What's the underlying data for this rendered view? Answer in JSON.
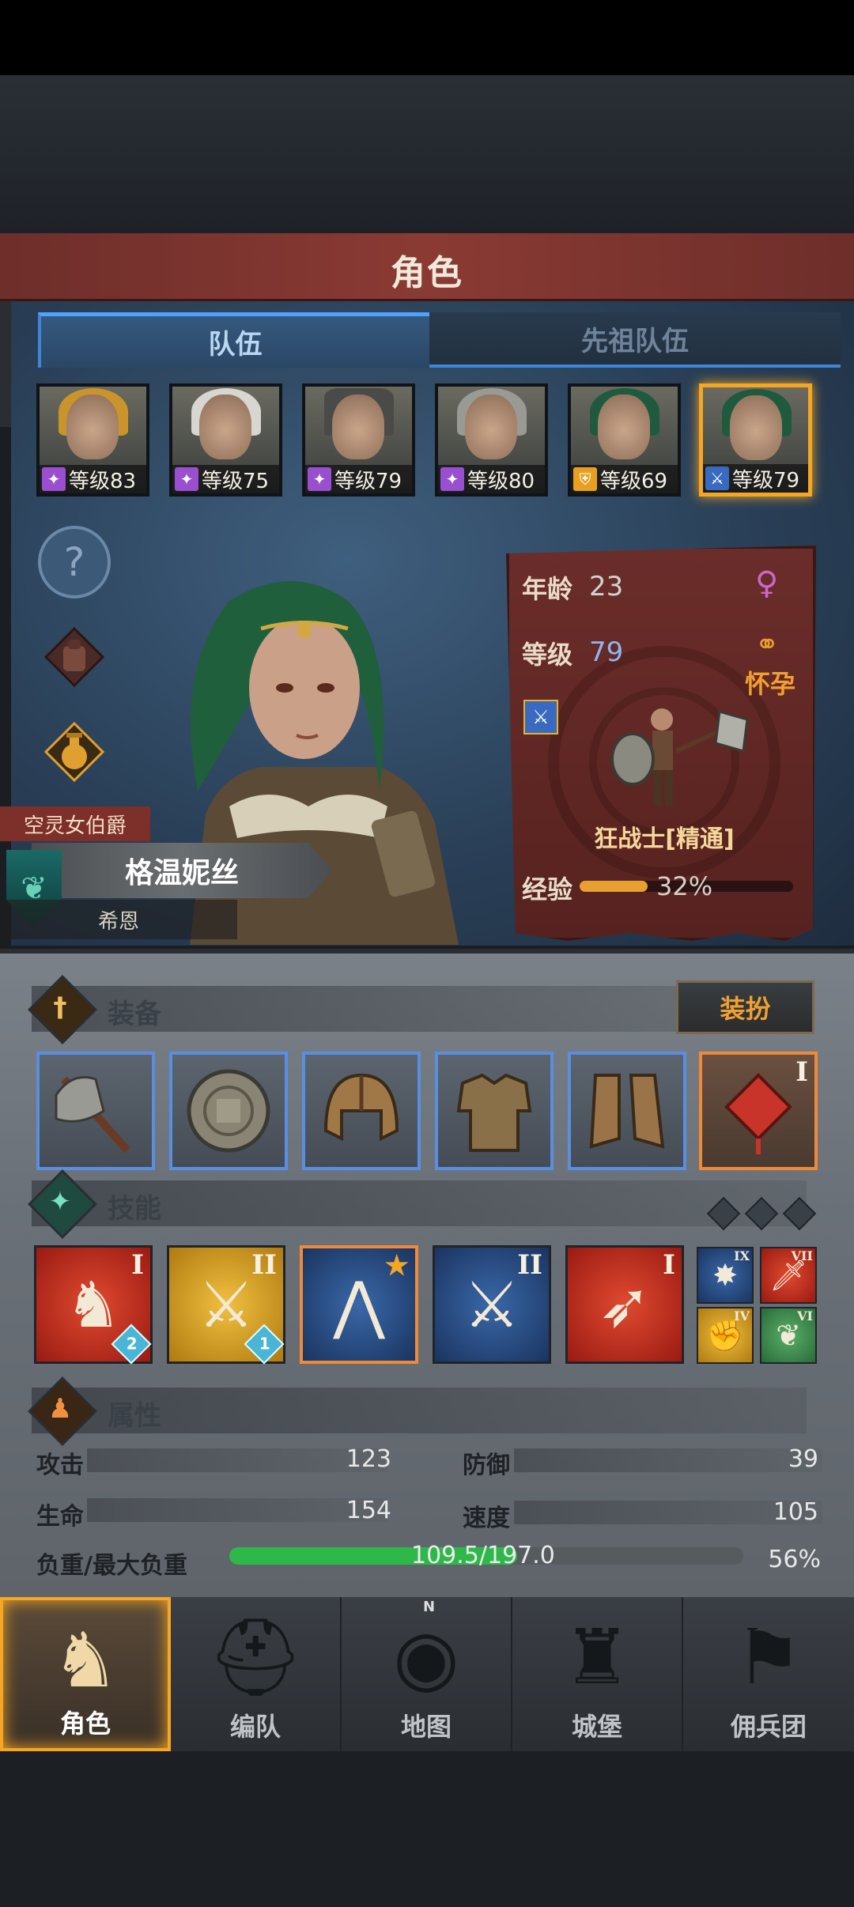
{
  "title": "角色",
  "tabs": [
    {
      "label": "队伍",
      "active": true
    },
    {
      "label": "先祖队伍",
      "active": false
    }
  ],
  "heroes": [
    {
      "label": "等级83",
      "class_icon": "wand-icon",
      "class_color": "#9a4fd0"
    },
    {
      "label": "等级75",
      "class_icon": "wand-icon",
      "class_color": "#9a4fd0"
    },
    {
      "label": "等级79",
      "class_icon": "wand-icon",
      "class_color": "#9a4fd0"
    },
    {
      "label": "等级80",
      "class_icon": "wand-icon",
      "class_color": "#9a4fd0"
    },
    {
      "label": "等级69",
      "class_icon": "shield-icon",
      "class_color": "#e8a020"
    },
    {
      "label": "等级79",
      "class_icon": "sword-icon",
      "class_color": "#3a6abf",
      "selected": true
    }
  ],
  "character": {
    "title": "空灵女伯爵",
    "name": "格温妮丝",
    "subname": "希恩"
  },
  "stats": {
    "age_label": "年龄",
    "age": "23",
    "level_label": "等级",
    "level": "79",
    "status": "怀孕",
    "class_name": "狂战士[精通]",
    "exp_label": "经验",
    "exp_pct": "32%",
    "exp_fraction": 0.32
  },
  "equipment": {
    "title": "装备",
    "dress_button": "装扮",
    "items": [
      {
        "icon": "axe-icon"
      },
      {
        "icon": "round-shield-icon"
      },
      {
        "icon": "helmet-icon"
      },
      {
        "icon": "armor-icon"
      },
      {
        "icon": "boots-icon"
      },
      {
        "icon": "charm-knot-icon",
        "rank": "I"
      }
    ]
  },
  "skills": {
    "title": "技能",
    "main": [
      {
        "icon": "target-horse-icon",
        "rank": "I",
        "badge": "2",
        "bg": "#c62b20"
      },
      {
        "icon": "sword-cross-icon",
        "rank": "II",
        "badge": "1",
        "bg": "#d4a52a"
      },
      {
        "icon": "claw-icon",
        "rank": "",
        "star": true,
        "bg": "#2f4f7f"
      },
      {
        "icon": "sword-slash-icon",
        "rank": "II",
        "bg": "#2f4f7f"
      },
      {
        "icon": "bow-icon",
        "rank": "I",
        "bg": "#c62b20"
      }
    ],
    "mini": [
      {
        "icon": "burst-icon",
        "rank": "IX",
        "bg": "#2f4f7f"
      },
      {
        "icon": "dagger-icon",
        "rank": "VII",
        "bg": "#c62b20"
      },
      {
        "icon": "fist-icon",
        "rank": "IV",
        "bg": "#d4a52a"
      },
      {
        "icon": "wing-icon",
        "rank": "VI",
        "bg": "#3a8a4a"
      }
    ]
  },
  "attributes": {
    "title": "属性",
    "attack_label": "攻击",
    "attack": "123",
    "defense_label": "防御",
    "defense": "39",
    "hp_label": "生命",
    "hp": "154",
    "speed_label": "速度",
    "speed": "105",
    "load_label": "负重/最大负重",
    "load": "109.5/197.0",
    "load_pct": "56%",
    "load_fraction": 0.56
  },
  "nav": [
    {
      "label": "角色",
      "icon": "knight-icon",
      "active": true
    },
    {
      "label": "编队",
      "icon": "helmet-group-icon"
    },
    {
      "label": "地图",
      "icon": "compass-map-icon"
    },
    {
      "label": "城堡",
      "icon": "castle-icon"
    },
    {
      "label": "佣兵团",
      "icon": "mercenary-icon"
    }
  ],
  "compass_n": "N"
}
